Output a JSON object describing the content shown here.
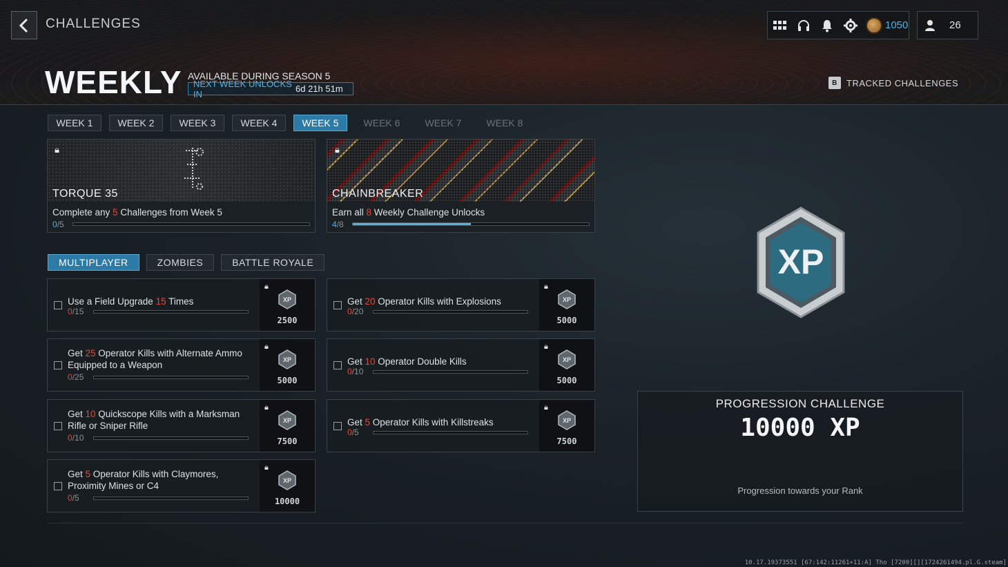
{
  "header": {
    "back_icon": "chevron-left-icon",
    "page_title": "CHALLENGES",
    "weekly_title": "WEEKLY",
    "season_label": "AVAILABLE DURING SEASON 5",
    "next_unlock_label": "NEXT WEEK UNLOCKS IN",
    "next_unlock_value": "6d 21h 51m",
    "tracked_key": "B",
    "tracked_label": "TRACKED CHALLENGES"
  },
  "topbar": {
    "icons": [
      "grid-icon",
      "headset-icon",
      "bell-icon",
      "gear-icon"
    ],
    "cod_points": "1050",
    "friends_count": "26"
  },
  "week_tabs": [
    {
      "label": "WEEK 1",
      "state": "normal"
    },
    {
      "label": "WEEK 2",
      "state": "normal"
    },
    {
      "label": "WEEK 3",
      "state": "normal"
    },
    {
      "label": "WEEK 4",
      "state": "normal"
    },
    {
      "label": "WEEK 5",
      "state": "active"
    },
    {
      "label": "WEEK 6",
      "state": "locked"
    },
    {
      "label": "WEEK 7",
      "state": "locked"
    },
    {
      "label": "WEEK 8",
      "state": "locked"
    }
  ],
  "rewards": [
    {
      "name": "TORQUE 35",
      "desc_pre": "Complete any ",
      "desc_hl": "5",
      "desc_post": " Challenges from Week 5",
      "progress": "0",
      "total": "/5",
      "fraction": 0.0
    },
    {
      "name": "CHAINBREAKER",
      "desc_pre": "Earn all ",
      "desc_hl": "8",
      "desc_post": " Weekly Challenge Unlocks",
      "progress": "4",
      "total": "/8",
      "fraction": 0.5
    }
  ],
  "mode_tabs": [
    {
      "label": "MULTIPLAYER",
      "active": true
    },
    {
      "label": "ZOMBIES",
      "active": false
    },
    {
      "label": "BATTLE ROYALE",
      "active": false
    }
  ],
  "challenges": [
    {
      "pre": "Use a Field Upgrade ",
      "hl": "15",
      "post": " Times",
      "progress": "0",
      "total": "/15",
      "xp": "2500",
      "fraction": 0.0
    },
    {
      "pre": "Get ",
      "hl": "20",
      "post": " Operator Kills with Explosions",
      "progress": "0",
      "total": "/20",
      "xp": "5000",
      "fraction": 0.0
    },
    {
      "pre": "Get ",
      "hl": "25",
      "post": " Operator Kills with Alternate Ammo Equipped to a Weapon",
      "progress": "0",
      "total": "/25",
      "xp": "5000",
      "fraction": 0.0
    },
    {
      "pre": "Get ",
      "hl": "10",
      "post": " Operator Double Kills",
      "progress": "0",
      "total": "/10",
      "xp": "5000",
      "fraction": 0.0
    },
    {
      "pre": "Get ",
      "hl": "10",
      "post": " Quickscope Kills with a Marksman Rifle or Sniper Rifle",
      "progress": "0",
      "total": "/10",
      "xp": "7500",
      "fraction": 0.0
    },
    {
      "pre": "Get ",
      "hl": "5",
      "post": " Operator Kills with Killstreaks",
      "progress": "0",
      "total": "/5",
      "xp": "7500",
      "fraction": 0.0
    },
    {
      "pre": "Get ",
      "hl": "5",
      "post": " Operator Kills with Claymores, Proximity Mines or C4",
      "progress": "0",
      "total": "/5",
      "xp": "10000",
      "fraction": 0.0
    }
  ],
  "progression": {
    "badge_text": "XP",
    "heading": "PROGRESSION CHALLENGE",
    "xp_value": "10000 XP",
    "subtitle": "Progression towards your Rank"
  },
  "build_string": "10.17.19373551 [67:142:11261+11:A] Tho [7200][][1724261494.pl.G.steam]",
  "colors": {
    "accent": "#2c7aa6",
    "highlight": "#e24a3a",
    "progress_blue": "#4fb3e6"
  }
}
